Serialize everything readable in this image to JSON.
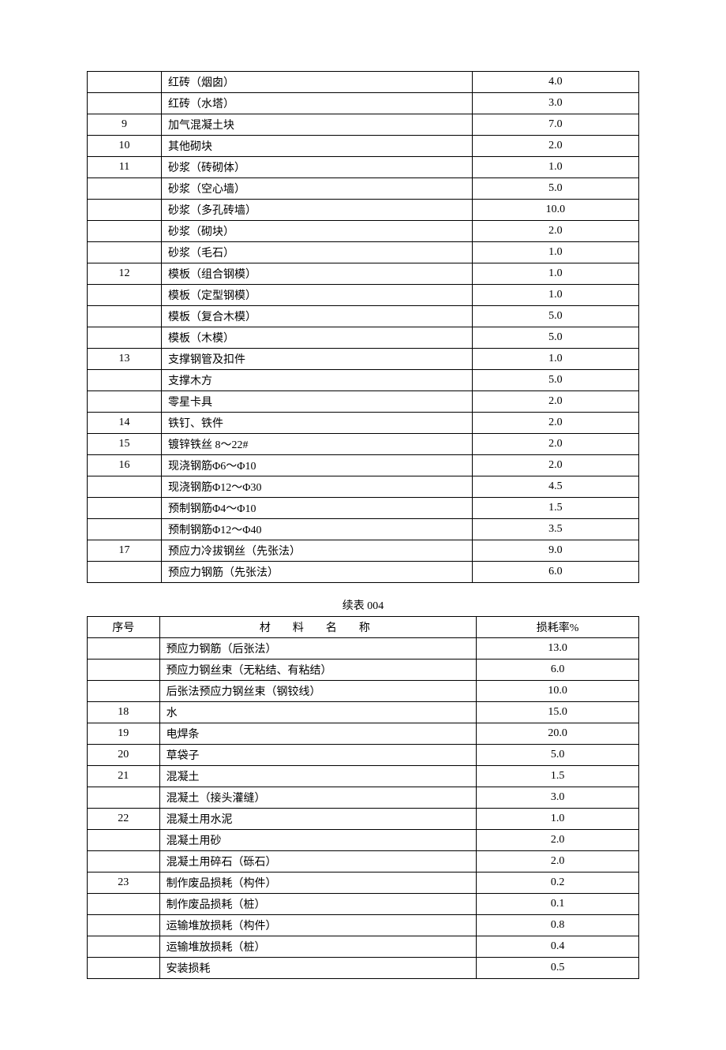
{
  "table1": {
    "rows": [
      {
        "seq": "",
        "name": "红砖（烟囱）",
        "rate": "4.0"
      },
      {
        "seq": "",
        "name": "红砖（水塔）",
        "rate": "3.0"
      },
      {
        "seq": "9",
        "name": "加气混凝土块",
        "rate": "7.0"
      },
      {
        "seq": "10",
        "name": "其他砌块",
        "rate": "2.0"
      },
      {
        "seq": "11",
        "name": "砂浆（砖砌体）",
        "rate": "1.0"
      },
      {
        "seq": "",
        "name": "砂浆（空心墙）",
        "rate": "5.0"
      },
      {
        "seq": "",
        "name": "砂浆（多孔砖墙）",
        "rate": "10.0"
      },
      {
        "seq": "",
        "name": "砂浆（砌块）",
        "rate": "2.0"
      },
      {
        "seq": "",
        "name": "砂浆（毛石）",
        "rate": "1.0"
      },
      {
        "seq": "12",
        "name": "模板（组合钢模）",
        "rate": "1.0"
      },
      {
        "seq": "",
        "name": "模板（定型钢模）",
        "rate": "1.0"
      },
      {
        "seq": "",
        "name": "模板（复合木模）",
        "rate": "5.0"
      },
      {
        "seq": "",
        "name": "模板（木模）",
        "rate": "5.0"
      },
      {
        "seq": "13",
        "name": "支撑钢管及扣件",
        "rate": "1.0"
      },
      {
        "seq": "",
        "name": "支撑木方",
        "rate": "5.0"
      },
      {
        "seq": "",
        "name": "零星卡具",
        "rate": "2.0"
      },
      {
        "seq": "14",
        "name": "铁钉、铁件",
        "rate": "2.0"
      },
      {
        "seq": "15",
        "name": "镀锌铁丝 8～22#",
        "rate": "2.0"
      },
      {
        "seq": "16",
        "name": "现浇钢筋Φ6～Φ10",
        "rate": "2.0"
      },
      {
        "seq": "",
        "name": "现浇钢筋Φ12～Φ30",
        "rate": "4.5"
      },
      {
        "seq": "",
        "name": "预制钢筋Φ4～Φ10",
        "rate": "1.5"
      },
      {
        "seq": "",
        "name": "预制钢筋Φ12～Φ40",
        "rate": "3.5"
      },
      {
        "seq": "17",
        "name": "预应力冷拔钢丝（先张法）",
        "rate": "9.0"
      },
      {
        "seq": "",
        "name": "预应力钢筋（先张法）",
        "rate": "6.0"
      }
    ]
  },
  "caption2": "续表 004",
  "table2": {
    "headers": {
      "seq": "序号",
      "name": "材料名称",
      "rate": "损耗率%"
    },
    "rows": [
      {
        "seq": "",
        "name": "预应力钢筋（后张法）",
        "rate": "13.0"
      },
      {
        "seq": "",
        "name": "预应力钢丝束（无粘结、有粘结）",
        "rate": "6.0"
      },
      {
        "seq": "",
        "name": "后张法预应力钢丝束（钢铰线）",
        "rate": "10.0"
      },
      {
        "seq": "18",
        "name": "水",
        "rate": "15.0"
      },
      {
        "seq": "19",
        "name": "电焊条",
        "rate": "20.0"
      },
      {
        "seq": "20",
        "name": "草袋子",
        "rate": "5.0"
      },
      {
        "seq": "21",
        "name": "混凝土",
        "rate": "1.5"
      },
      {
        "seq": "",
        "name": "混凝土（接头灌缝）",
        "rate": "3.0"
      },
      {
        "seq": "22",
        "name": "混凝土用水泥",
        "rate": "1.0"
      },
      {
        "seq": "",
        "name": "混凝土用砂",
        "rate": "2.0"
      },
      {
        "seq": "",
        "name": "混凝土用碎石（砾石）",
        "rate": "2.0"
      },
      {
        "seq": "23",
        "name": "制作废品损耗（构件）",
        "rate": "0.2"
      },
      {
        "seq": "",
        "name": "制作废品损耗（桩）",
        "rate": "0.1"
      },
      {
        "seq": "",
        "name": "运输堆放损耗（构件）",
        "rate": "0.8"
      },
      {
        "seq": "",
        "name": "运输堆放损耗（桩）",
        "rate": "0.4"
      },
      {
        "seq": "",
        "name": "安装损耗",
        "rate": "0.5"
      }
    ]
  }
}
